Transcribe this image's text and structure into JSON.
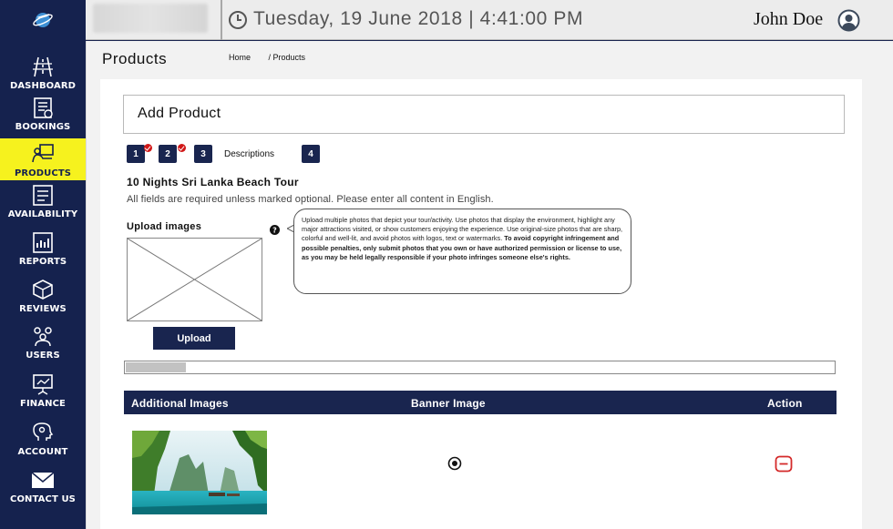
{
  "header": {
    "datetime": "Tuesday, 19 June 2018 | 4:41:00 PM",
    "username": "John Doe"
  },
  "sidebar": {
    "items": [
      {
        "label": "DASHBOARD",
        "icon": "dashboard-road-icon"
      },
      {
        "label": "BOOKINGS",
        "icon": "bookings-icon"
      },
      {
        "label": "PRODUCTS",
        "icon": "products-icon",
        "active": true
      },
      {
        "label": "AVAILABILITY",
        "icon": "availability-icon"
      },
      {
        "label": "REPORTS",
        "icon": "reports-icon"
      },
      {
        "label": "REVIEWS",
        "icon": "reviews-icon"
      },
      {
        "label": "USERS",
        "icon": "users-icon"
      },
      {
        "label": "FINANCE",
        "icon": "finance-icon"
      },
      {
        "label": "ACCOUNT",
        "icon": "account-icon"
      },
      {
        "label": "CONTACT US",
        "icon": "envelope-icon"
      }
    ]
  },
  "page": {
    "title": "Products",
    "breadcrumb": [
      "Home",
      "/ Products"
    ]
  },
  "form": {
    "heading": "Add Product",
    "steps": [
      {
        "number": "1",
        "completed": true
      },
      {
        "number": "2",
        "completed": true
      },
      {
        "number": "3",
        "label": "Descriptions"
      },
      {
        "number": "4"
      }
    ],
    "tour_title": "10 Nights Sri Lanka Beach Tour",
    "instructions": "All fields are required unless marked optional. Please enter all content in English.",
    "upload_label": "Upload images",
    "tooltip_text": "Upload multiple photos that depict your tour/activity. Use photos that display the environment, highlight any major attractions visited, or show customers enjoying the experience. Use original-size photos that are sharp, colorful and well-lit, and avoid photos with logos, text or watermarks.",
    "tooltip_bold": "To avoid copyright infringement and possible penalties, only submit photos that you own or have authorized permission or license to use, as you may be held legally responsible if your photo infringes someone else's rights.",
    "upload_button": "Upload",
    "upload_progress": 0.085
  },
  "images_table": {
    "headers": [
      "Additional Images",
      "Banner Image",
      "Action"
    ],
    "rows": [
      {
        "image": "tropical beach lagoon with boats",
        "banner_selected": true,
        "action": "remove"
      }
    ]
  },
  "colors": {
    "navy": "#19254f",
    "sidebar": "#15224e",
    "active_nav": "#f6f21e",
    "check_red": "#d11818",
    "remove_red": "#d42a2a"
  }
}
